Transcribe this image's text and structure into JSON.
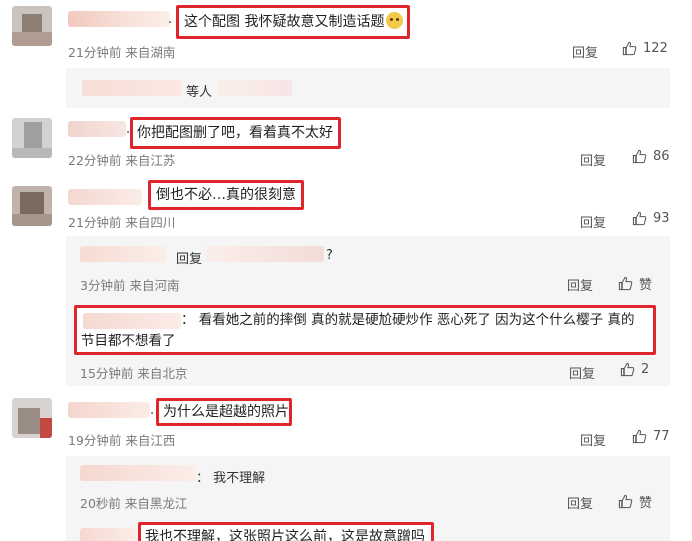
{
  "comments": [
    {
      "text": "这个配图 我怀疑故意又制造话题",
      "time": "21分钟前",
      "location": "来自湖南",
      "reply": "回复",
      "likes": "122"
    },
    {
      "text": "你把配图删了吧，看着真不太好",
      "time": "22分钟前",
      "location": "来自江苏",
      "reply": "回复",
      "likes": "86"
    },
    {
      "text": "倒也不必…真的很刻意",
      "time": "21分钟前",
      "location": "来自四川",
      "reply": "回复",
      "likes": "93"
    },
    {
      "text": "为什么是超越的照片",
      "time": "19分钟前",
      "location": "来自江西",
      "reply": "回复",
      "likes": "77"
    }
  ],
  "sub1": {
    "text": "等人"
  },
  "sub3": [
    {
      "prefix": "回复",
      "suffix": "?",
      "time": "3分钟前",
      "location": "来自河南",
      "reply": "回复",
      "likes": "赞"
    },
    {
      "line1": "：  看看她之前的摔倒 真的就是硬尬硬炒作 恶心死了 因为这个什么樱子 真的",
      "line2": "节目都不想看了",
      "time": "15分钟前",
      "location": "来自北京",
      "reply": "回复",
      "likes": "2"
    }
  ],
  "sub4": [
    {
      "text": "：  我不理解",
      "time": "20秒前",
      "location": "来自黑龙江",
      "reply": "回复",
      "likes": "赞"
    },
    {
      "text": "我也不理解，这张照片这么前，这是故意蹭吗"
    }
  ],
  "punct": "."
}
